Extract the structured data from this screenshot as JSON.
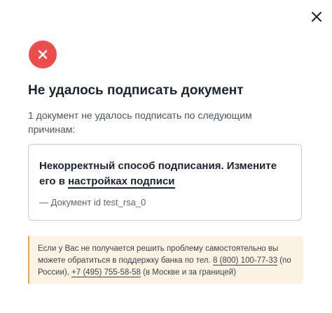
{
  "dialog": {
    "close_icon": "close-icon",
    "status_icon": "error-cross-icon",
    "status_color": "#eb4d4d",
    "title": "Не удалось подписать документ",
    "subtitle": "1 документ не удалось подписать по следующим причинам:"
  },
  "reason": {
    "text_before_link": "Некорректный способ подписания. Измените его в ",
    "link_text": "настройках подписи",
    "document_line": "— Документ id test_rsa_0"
  },
  "support_note": {
    "accent_color": "#f0a545",
    "background_color": "#fdf3e4",
    "text_part1": "Если у Вас не получается решить проблему самостоятельно вы можете обратиться в поддержку банка по тел. ",
    "phone1": "8 (800) 100-77-33",
    "text_part2": " (по России), ",
    "phone2": "+7 (495) 755-58-58",
    "text_part3": " (в Москве и за границей)"
  }
}
